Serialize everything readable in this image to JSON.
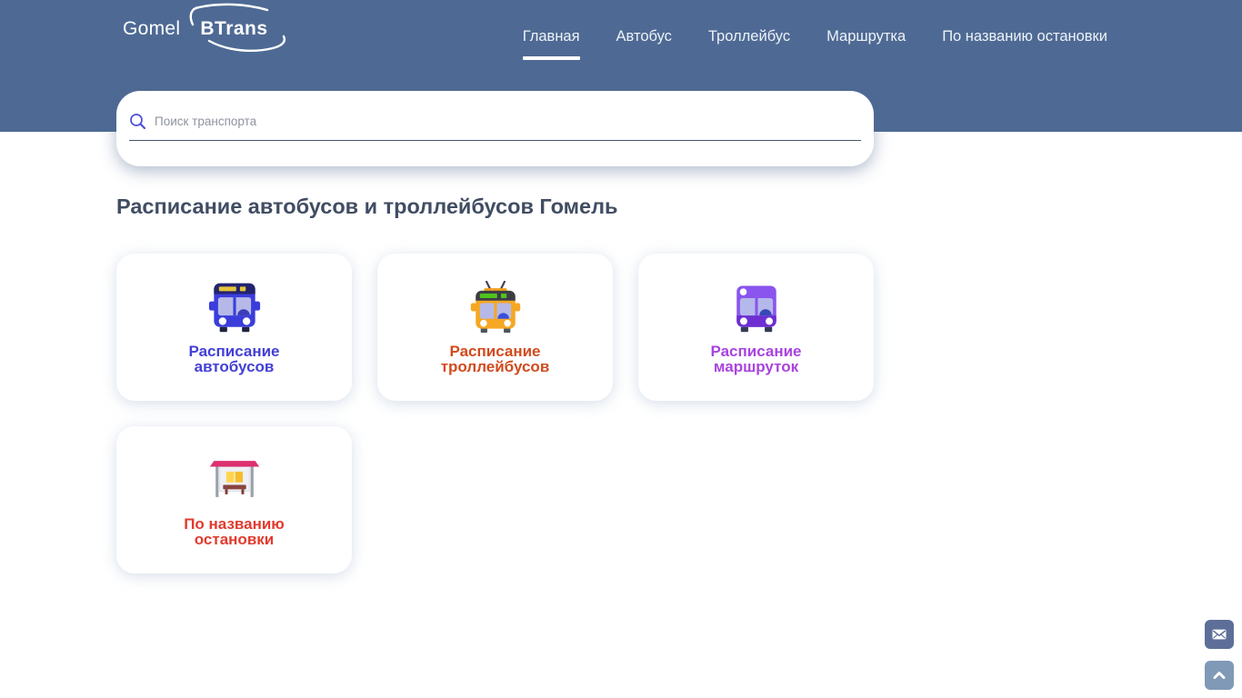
{
  "header": {
    "logo": {
      "prefix": "Gomel",
      "brand": "BTrans"
    },
    "nav": [
      {
        "label": "Главная",
        "active": true
      },
      {
        "label": "Автобус",
        "active": false
      },
      {
        "label": "Троллейбус",
        "active": false
      },
      {
        "label": "Маршрутка",
        "active": false
      },
      {
        "label": "По названию остановки",
        "active": false
      }
    ]
  },
  "search": {
    "placeholder": "Поиск транспорта",
    "icon": "search-icon"
  },
  "main": {
    "heading": "Расписание автобусов и троллейбусов Гомель",
    "cards": [
      {
        "label": "Расписание автобусов",
        "icon": "bus-icon",
        "label_color": "#4340d6"
      },
      {
        "label": "Расписание троллейбусов",
        "icon": "trolleybus-icon",
        "label_color": "#d14b1e"
      },
      {
        "label": "Расписание маршруток",
        "icon": "minibus-icon",
        "label_color": "#a844e0"
      },
      {
        "label": "По названию остановки",
        "icon": "bus-stop-icon",
        "label_color": "#e23b2e"
      }
    ]
  },
  "floating": {
    "email_icon": "envelope-icon",
    "scroll_top_icon": "chevron-up-icon"
  },
  "colors": {
    "header_bg": "#4e6a94",
    "heading_text": "#414d63",
    "active_nav_underline": "#ffffff",
    "search_underline": "#4a566e",
    "email_button_bg": "#5d6f99",
    "scroll_button_bg": "#8099b7"
  }
}
